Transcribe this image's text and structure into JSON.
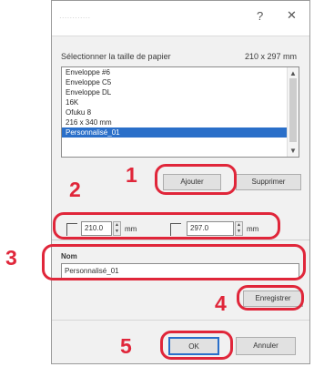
{
  "dialog": {
    "title": "············",
    "help_glyph": "?",
    "close_glyph": "✕"
  },
  "paper": {
    "label": "Sélectionner la taille de papier",
    "size_readout": "210 x 297 mm",
    "items": [
      "Enveloppe #6",
      "Enveloppe C5",
      "Enveloppe DL",
      "16K",
      "Ofuku 8",
      "216 x 340 mm",
      "Personnalisé_01"
    ],
    "selected_index": 6
  },
  "buttons": {
    "add": "Ajouter",
    "delete": "Supprimer",
    "save": "Enregistrer",
    "ok": "OK",
    "cancel": "Annuler"
  },
  "dimensions": {
    "width_value": "210.0",
    "height_value": "297.0",
    "unit": "mm"
  },
  "name_field": {
    "label": "Nom",
    "value": "Personnalisé_01"
  },
  "steps": [
    "1",
    "2",
    "3",
    "4",
    "5"
  ],
  "colors": {
    "callout": "#e0263a",
    "selection": "#2a6fc9"
  }
}
